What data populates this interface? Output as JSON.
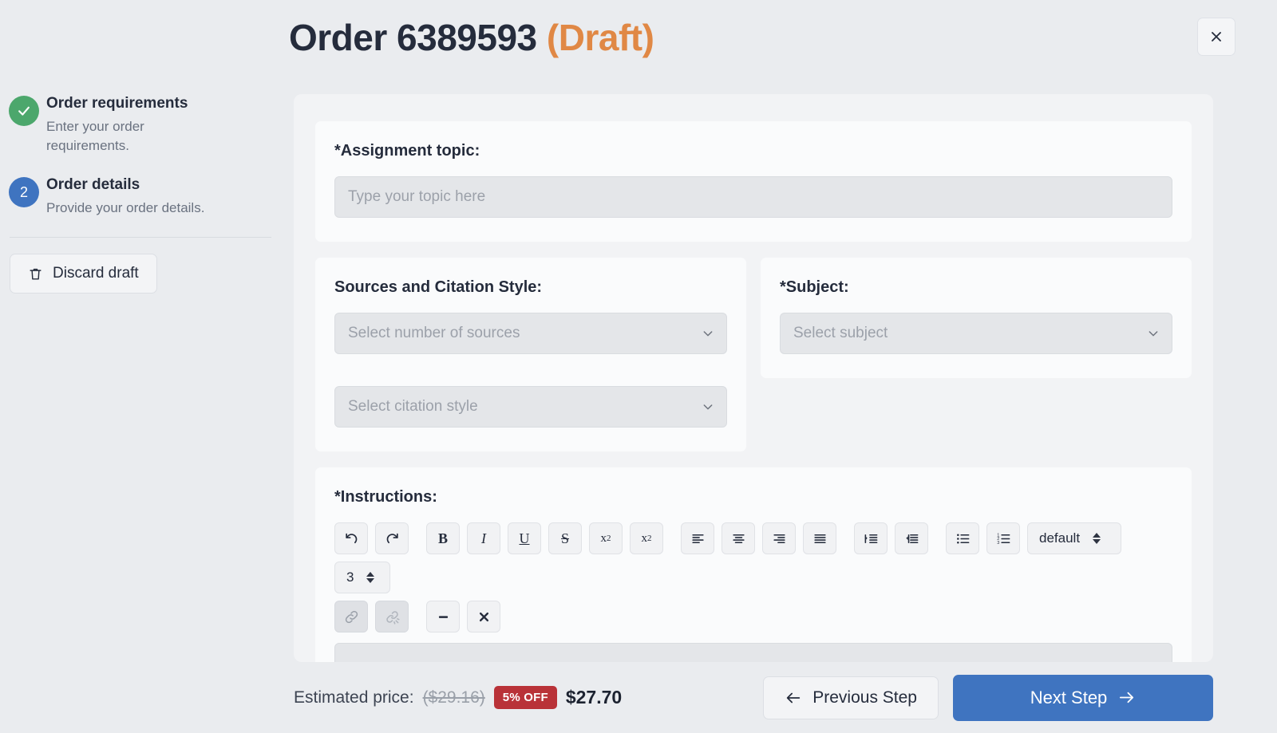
{
  "header": {
    "title_main": "Order 6389593",
    "title_status": "(Draft)",
    "close_label": "✕"
  },
  "sidebar": {
    "steps": [
      {
        "bullet": "✓",
        "title": "Order requirements",
        "desc": "Enter your order requirements."
      },
      {
        "bullet": "2",
        "title": "Order details",
        "desc": "Provide your order details."
      }
    ],
    "discard_label": "Discard draft"
  },
  "form": {
    "topic": {
      "label": "*Assignment topic:",
      "placeholder": "Type your topic here",
      "value": ""
    },
    "sources": {
      "label": "Sources and Citation Style:",
      "number_placeholder": "Select number of sources",
      "number_value": "",
      "style_placeholder": "Select citation style",
      "style_value": ""
    },
    "subject": {
      "label": "*Subject:",
      "placeholder": "Select subject",
      "value": ""
    },
    "instructions": {
      "label": "*Instructions:",
      "value": ""
    }
  },
  "toolbar": {
    "buttons_row1": [
      {
        "name": "undo",
        "glyph": "↺"
      },
      {
        "name": "redo",
        "glyph": "↻"
      },
      {
        "name": "bold",
        "glyph": "B"
      },
      {
        "name": "italic",
        "glyph": "I"
      },
      {
        "name": "underline",
        "glyph": "U"
      },
      {
        "name": "strikethrough",
        "glyph": "S"
      },
      {
        "name": "subscript",
        "glyph": "x₂"
      },
      {
        "name": "superscript",
        "glyph": "x²"
      },
      {
        "name": "align-left",
        "glyph": ""
      },
      {
        "name": "align-center",
        "glyph": ""
      },
      {
        "name": "align-right",
        "glyph": ""
      },
      {
        "name": "align-justify",
        "glyph": ""
      },
      {
        "name": "indent",
        "glyph": ""
      },
      {
        "name": "outdent",
        "glyph": ""
      },
      {
        "name": "bullet-list",
        "glyph": ""
      },
      {
        "name": "numbered-list",
        "glyph": ""
      }
    ],
    "font_select_value": "default",
    "size_select_value": "3",
    "buttons_row2": [
      {
        "name": "insert-link",
        "glyph": "🔗",
        "disabled": true
      },
      {
        "name": "remove-link",
        "glyph": "⛓",
        "disabled": true
      },
      {
        "name": "horizontal-rule",
        "glyph": "▬",
        "disabled": false
      },
      {
        "name": "clear-formatting",
        "glyph": "✖",
        "disabled": false
      }
    ]
  },
  "footer": {
    "price_label": "Estimated price:",
    "price_original": "($29.16)",
    "discount_badge": "5% OFF",
    "price_final": "$27.70",
    "previous_label": "Previous Step",
    "next_label": "Next Step"
  },
  "colors": {
    "accent_blue": "#3f74c0",
    "step_done_green": "#4ca76c",
    "draft_orange": "#e08845",
    "discount_red": "#b93238",
    "page_bg": "#eaecef"
  }
}
